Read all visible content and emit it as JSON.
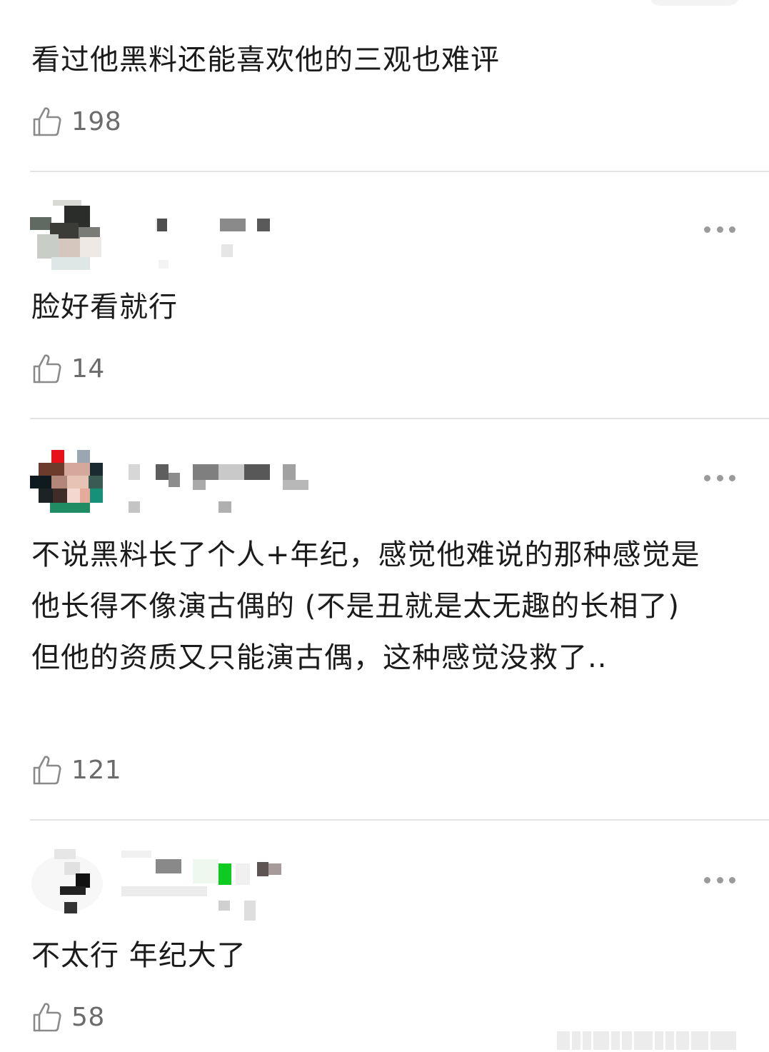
{
  "comments": [
    {
      "text": "看过他黑料还能喜欢他的三观也难评",
      "likes": "198"
    },
    {
      "text": "脸好看就行",
      "likes": "14"
    },
    {
      "text": "不说黑料长了个人+年纪，感觉他难说的那种感觉是他长得不像演古偶的 (不是丑就是太无趣的长相了) 但他的资质又只能演古偶，这种感觉没救了..",
      "likes": "121"
    },
    {
      "text": "不太行 年纪大了",
      "likes": "58"
    }
  ],
  "icons": {
    "like": "thumbs-up-icon",
    "more": "more-horizontal-icon"
  },
  "colors": {
    "text": "#1b1b1b",
    "meta": "#6b6b6b",
    "divider": "#e3e3e3",
    "more_dots": "#9a9a9a"
  }
}
